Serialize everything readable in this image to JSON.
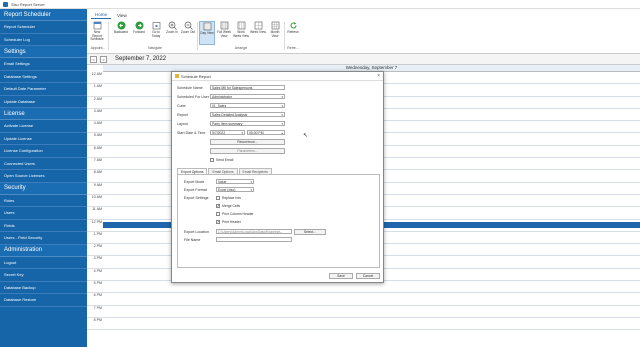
{
  "window": {
    "title": "Sisu Report Server"
  },
  "sidebar": {
    "sections": [
      {
        "title": "Report Scheduler",
        "items": [
          "Report Scheduler",
          "Scheduler Log"
        ]
      },
      {
        "title": "Settings",
        "items": [
          "Email Settings",
          "Database Settings",
          "Default Date Parameter",
          "Update Database"
        ]
      },
      {
        "title": "License",
        "items": [
          "Activate License",
          "Update License",
          "License Configuration",
          "Connected Users",
          "Open Source Licenses"
        ]
      },
      {
        "title": "Security",
        "items": [
          "Roles",
          "Users",
          "Fields",
          "Users - Field Security"
        ]
      },
      {
        "title": "Administration",
        "items": [
          "Logout",
          "Secret Key",
          "Database Backup",
          "Database Restore"
        ]
      }
    ]
  },
  "ribbon": {
    "tabs": [
      "Home",
      "View"
    ],
    "buttons": [
      {
        "label": "New Report Schedule",
        "icon": "new-schedule-icon"
      },
      {
        "label": "Backward",
        "icon": "backward-icon"
      },
      {
        "label": "Forward",
        "icon": "forward-icon"
      },
      {
        "label": "Go to Today",
        "icon": "today-icon"
      },
      {
        "label": "Zoom In",
        "icon": "zoom-in-icon"
      },
      {
        "label": "Zoom Out",
        "icon": "zoom-out-icon"
      },
      {
        "label": "Day View",
        "icon": "day-view-icon"
      },
      {
        "label": "Full Week View",
        "icon": "full-week-icon"
      },
      {
        "label": "Work Week View",
        "icon": "work-week-icon"
      },
      {
        "label": "Week View",
        "icon": "week-icon"
      },
      {
        "label": "Month View",
        "icon": "month-icon"
      },
      {
        "label": "Refresh",
        "icon": "refresh-icon"
      }
    ],
    "groups": [
      "Appoint...",
      "Navigate",
      "Arrange",
      "Refre..."
    ]
  },
  "datebar": {
    "prev": "<",
    "next": ">",
    "date": "September 7, 2022"
  },
  "calendar": {
    "day_header": "Wednesday, September 7",
    "times": [
      "12 AM",
      "1 AM",
      "2 AM",
      "3 AM",
      "4 AM",
      "5 AM",
      "6 AM",
      "7 AM",
      "8 AM",
      "9 AM",
      "10 AM",
      "11 AM",
      "12 PM",
      "1 PM",
      "2 PM",
      "3 PM",
      "4 PM",
      "5 PM",
      "6 PM",
      "7 PM",
      "8 PM"
    ]
  },
  "dialog": {
    "title": "Schedule Report",
    "close": "×",
    "fields": {
      "schedule_name": {
        "label": "Schedule Name",
        "value": "Sales Mtl for Salespersons"
      },
      "scheduled_for_user": {
        "label": "Scheduled For User",
        "value": "Administrator"
      },
      "cube": {
        "label": "Cube",
        "value": "01_Sales"
      },
      "report": {
        "label": "Report",
        "value": "Sales Detailed Analysis"
      },
      "layout": {
        "label": "Layout",
        "value": "Party Item summary"
      },
      "start_date_time": {
        "label": "Start Date & Time",
        "date": "9/7/2022",
        "time": "05:00 PM"
      }
    },
    "recurrence_button": "Recurrence...",
    "parameters_button": "Parameters...",
    "send_email": "Send Email",
    "tabs": [
      "Export Options",
      "Email Options",
      "Email Recipients"
    ],
    "export": {
      "mode_label": "Export Mode",
      "mode_value": "Value",
      "format_label": "Export Format",
      "format_value": "Excel (xlsx)",
      "settings_label": "Export Settings",
      "options": [
        {
          "label": "Replace Info",
          "checked": false
        },
        {
          "label": "Merge Cells",
          "checked": true
        },
        {
          "label": "Print Column Header",
          "checked": false
        },
        {
          "label": "Print Header",
          "checked": true
        }
      ],
      "location_label": "Export Location",
      "location_value": "C:\\Users\\Admin\\Local\\AppData\\Roaming\\...",
      "select_button": "Select...",
      "filename_label": "File Name"
    },
    "save": "Save",
    "cancel": "Cancel"
  }
}
